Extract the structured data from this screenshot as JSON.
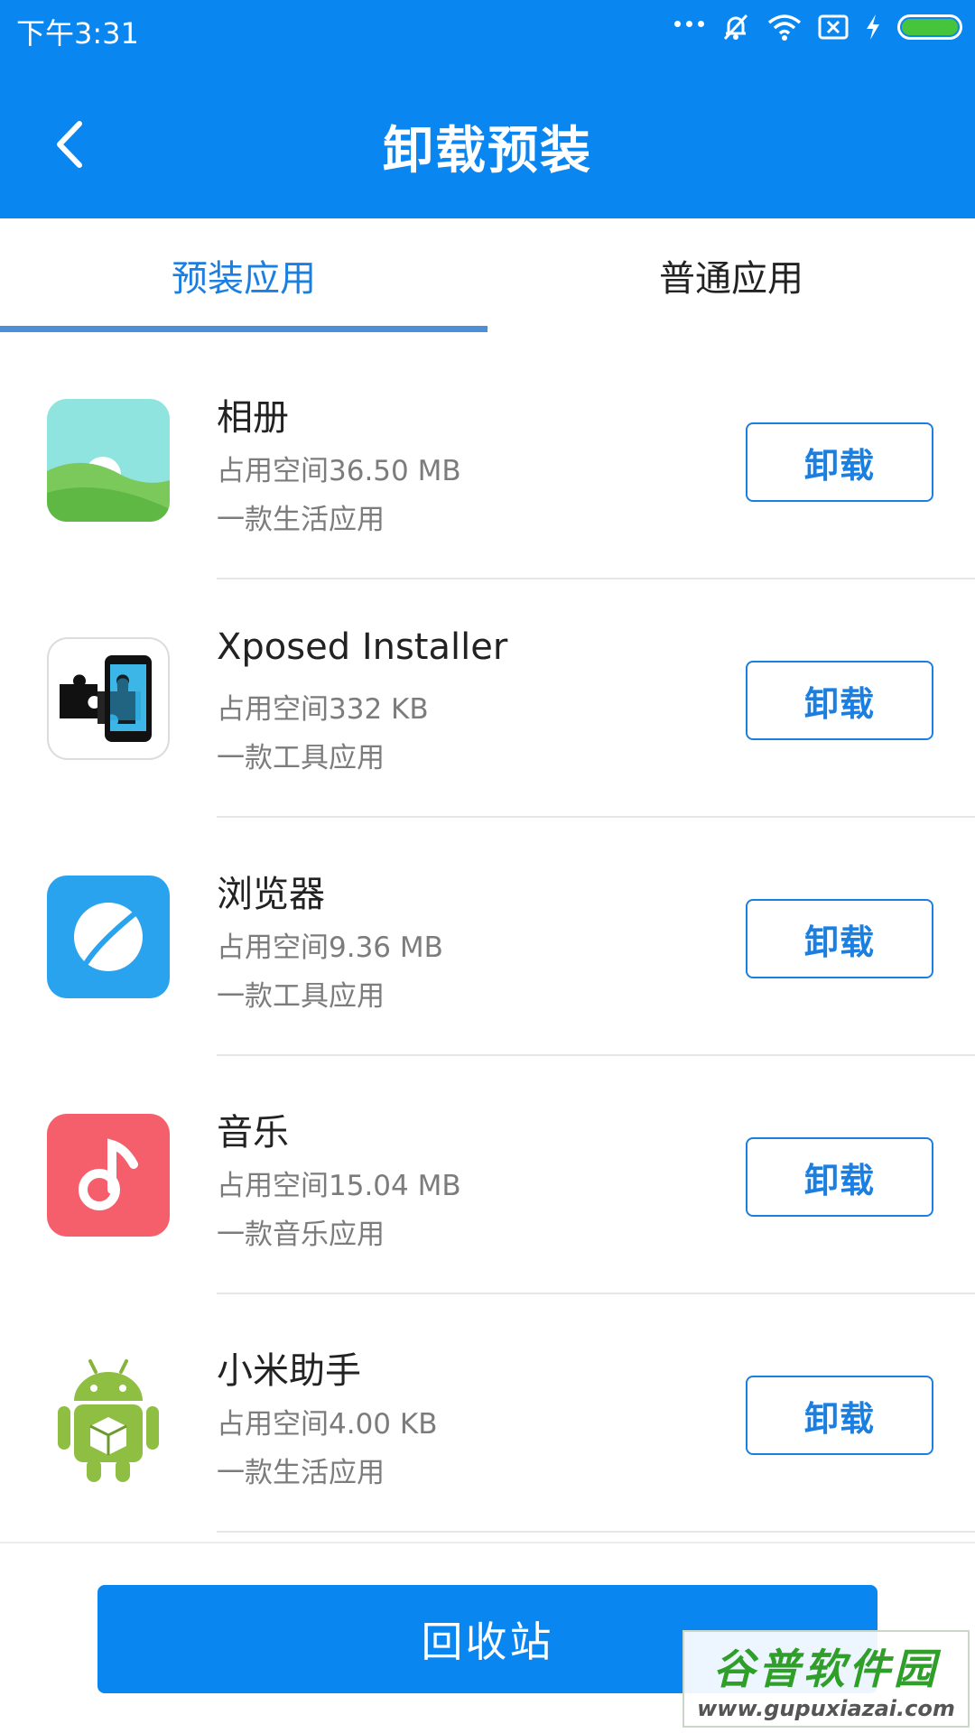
{
  "status_bar": {
    "time": "下午3:31",
    "icons": [
      "more-dots-icon",
      "mute-notification-icon",
      "wifi-icon",
      "no-sim-icon",
      "charging-bolt-icon",
      "battery-icon"
    ],
    "battery_color": "#45c43c"
  },
  "header": {
    "title": "卸载预装",
    "back_icon": "chevron-left-icon",
    "background": "#0a86f0"
  },
  "tabs": [
    {
      "label": "预装应用",
      "active": true
    },
    {
      "label": "普通应用",
      "active": false
    }
  ],
  "apps": [
    {
      "name": "相册",
      "size": "占用空间36.50 MB",
      "desc": "一款生活应用",
      "icon": "gallery-icon",
      "action": "卸载"
    },
    {
      "name": "Xposed Installer",
      "size": "占用空间332 KB",
      "desc": "一款工具应用",
      "icon": "xposed-puzzle-icon",
      "action": "卸载"
    },
    {
      "name": "浏览器",
      "size": "占用空间9.36 MB",
      "desc": "一款工具应用",
      "icon": "browser-icon",
      "action": "卸载"
    },
    {
      "name": "音乐",
      "size": "占用空间15.04 MB",
      "desc": "一款音乐应用",
      "icon": "music-note-icon",
      "action": "卸载"
    },
    {
      "name": "小米助手",
      "size": "占用空间4.00 KB",
      "desc": "一款生活应用",
      "icon": "android-robot-icon",
      "action": "卸载"
    }
  ],
  "bottom": {
    "recycle_label": "回收站"
  },
  "watermark": {
    "title": "谷普软件园",
    "url": "www.gupuxiazai.com"
  },
  "colors": {
    "accent": "#1b7fe1",
    "primary": "#0a86f0",
    "secondary_text": "#7c7c7c"
  }
}
